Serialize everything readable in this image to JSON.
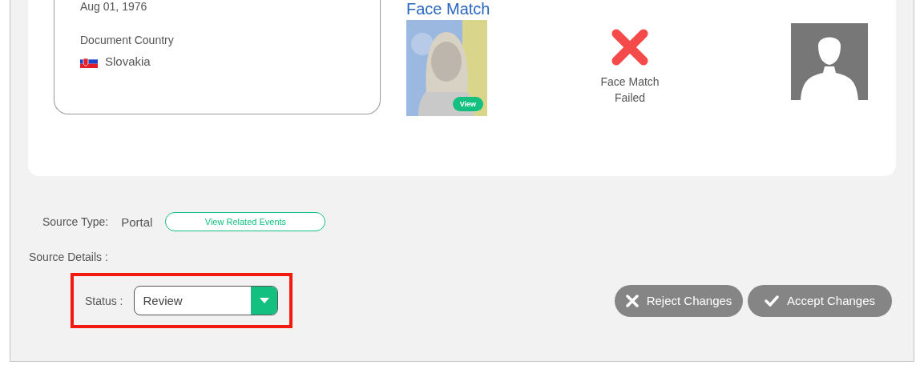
{
  "document": {
    "date": "Aug 01, 1976",
    "country_label": "Document Country",
    "country": "Slovakia"
  },
  "face_match": {
    "title": "Face Match",
    "photo_badge": "View",
    "result_lines": [
      "Face Match",
      "Failed"
    ],
    "passed": false
  },
  "source": {
    "type_label": "Source Type:",
    "type": "Portal",
    "related_button": "View Related Events",
    "details_label": "Source Details :"
  },
  "status": {
    "label": "Status :",
    "value": "Review"
  },
  "actions": [
    {
      "kind": "reject",
      "label": "Reject Changes"
    },
    {
      "kind": "accept",
      "label": "Accept Changes"
    }
  ]
}
